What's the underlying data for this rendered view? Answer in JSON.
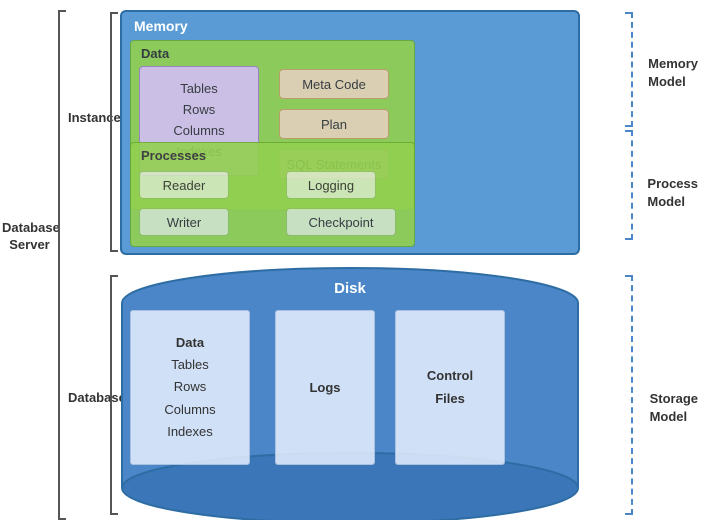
{
  "labels": {
    "db_server": "Database\nServer",
    "instance": "Instance",
    "database": "Database",
    "memory_model": "Memory\nModel",
    "process_model": "Process\nModel",
    "storage_model": "Storage\nModel",
    "memory_title": "Memory",
    "data_title": "Data",
    "processes_title": "Processes",
    "disk_title": "Disk"
  },
  "memory": {
    "data_inner": {
      "tables": "Tables",
      "rows": "Rows",
      "columns": "Columns",
      "indexes": "Indexes"
    },
    "meta_code": "Meta Code",
    "plan": "Plan",
    "sql_statements": "SQL Statements",
    "reader": "Reader",
    "logging": "Logging",
    "writer": "Writer",
    "checkpoint": "Checkpoint"
  },
  "disk": {
    "data_box": {
      "data": "Data",
      "tables": "Tables",
      "rows": "Rows",
      "columns": "Columns",
      "indexes": "Indexes"
    },
    "logs": "Logs",
    "control_files_1": "Control",
    "control_files_2": "Files"
  }
}
